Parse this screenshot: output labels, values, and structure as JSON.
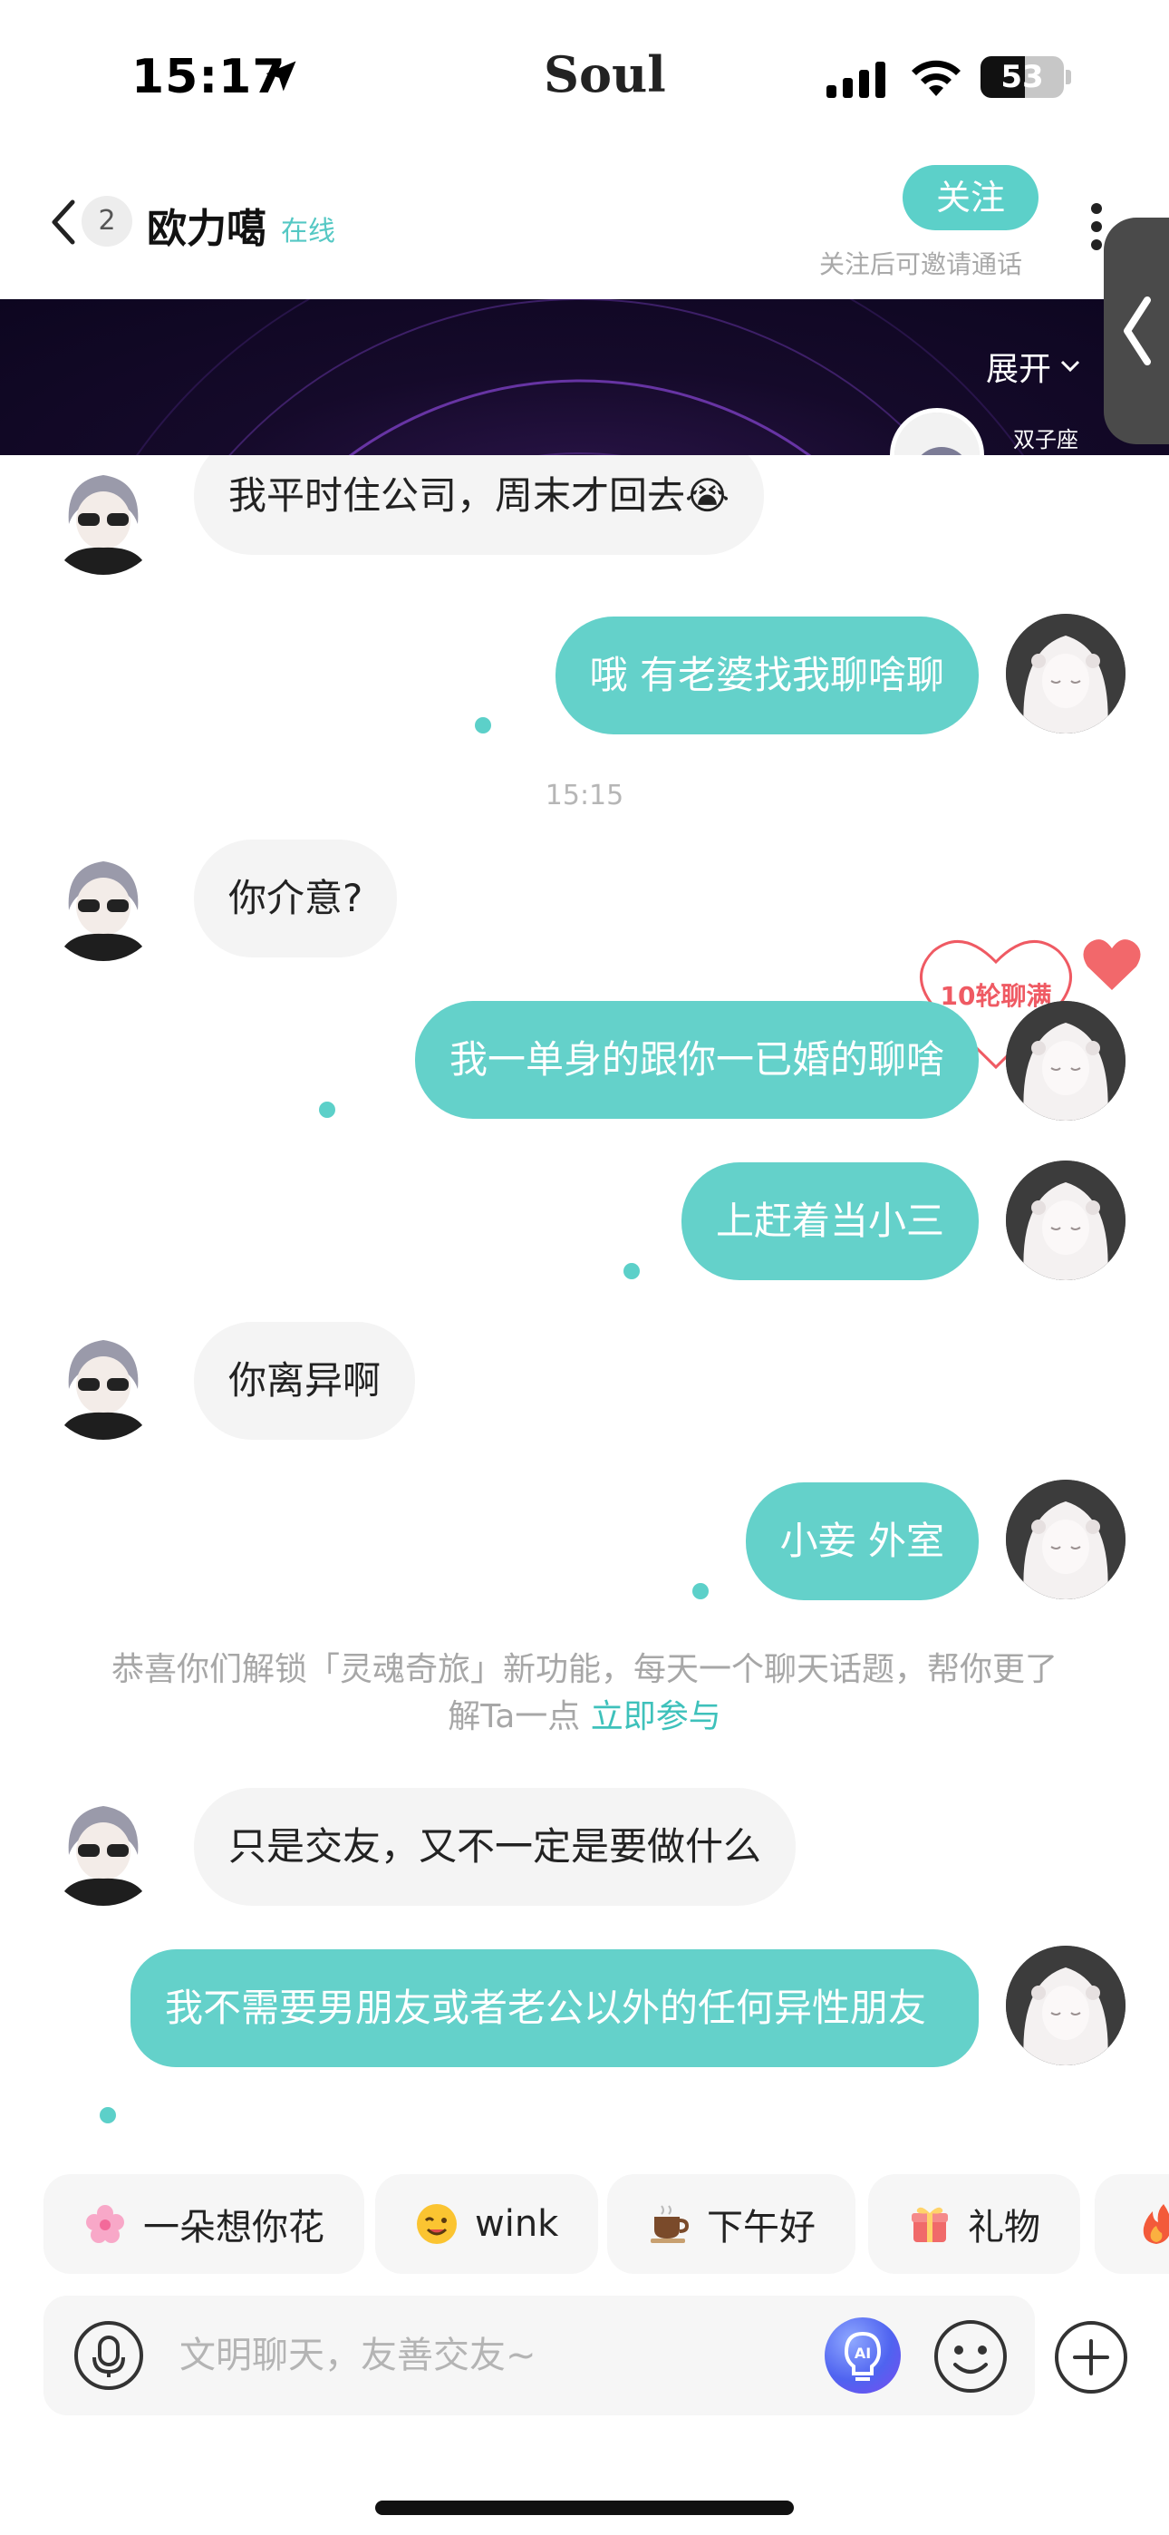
{
  "status_bar": {
    "time": "15:17",
    "app_name": "Soul",
    "battery_percent": 53,
    "battery_label": "53",
    "icons": [
      "location-arrow-icon",
      "cellular-signal-icon",
      "wifi-icon",
      "battery-icon"
    ]
  },
  "header": {
    "unread_count": "2",
    "contact_name": "欧力噶",
    "online_status": "在线",
    "follow_label": "关注",
    "follow_hint": "关注后可邀请通话"
  },
  "banner": {
    "expand_label": "展开",
    "zodiac": "双子座"
  },
  "chat_badge": {
    "label": "10轮聊满"
  },
  "messages": [
    {
      "side": "in",
      "text": "我平时住公司，周末才回去😭"
    },
    {
      "side": "out",
      "text": "哦 有老婆找我聊啥聊"
    },
    {
      "side": "out",
      "text": "我一单身的跟你一已婚的聊啥"
    },
    {
      "side": "out",
      "text": "上赶着当小三"
    },
    {
      "side": "in",
      "text": "你离异啊"
    },
    {
      "side": "out",
      "text": "小妾 外室"
    },
    {
      "side": "in",
      "text": "只是交友，又不一定是要做什么"
    },
    {
      "side": "out",
      "text": "我不需要男朋友或者老公以外的任何异性朋友"
    }
  ],
  "timestamp": "15:15",
  "messages_mid": [
    {
      "side": "in",
      "text": "你介意?"
    }
  ],
  "system_message": {
    "text": "恭喜你们解锁「灵魂奇旅」新功能，每天一个聊天话题，帮你更了解Ta一点",
    "link": "立即参与"
  },
  "quick_replies": [
    {
      "icon": "flower-icon",
      "label": "一朵想你花"
    },
    {
      "icon": "wink-emoji-icon",
      "label": "wink"
    },
    {
      "icon": "coffee-icon",
      "label": "下午好"
    },
    {
      "icon": "gift-icon",
      "label": "礼物"
    },
    {
      "icon": "fire-icon",
      "label": ""
    }
  ],
  "input_bar": {
    "placeholder": "文明聊天，友善交友~",
    "ai_label": "AI"
  },
  "colors": {
    "accent": "#5cd0c9",
    "outgoing_bubble": "#64d1ca",
    "incoming_bubble": "#f4f4f4",
    "heart": "#ef5a63"
  }
}
